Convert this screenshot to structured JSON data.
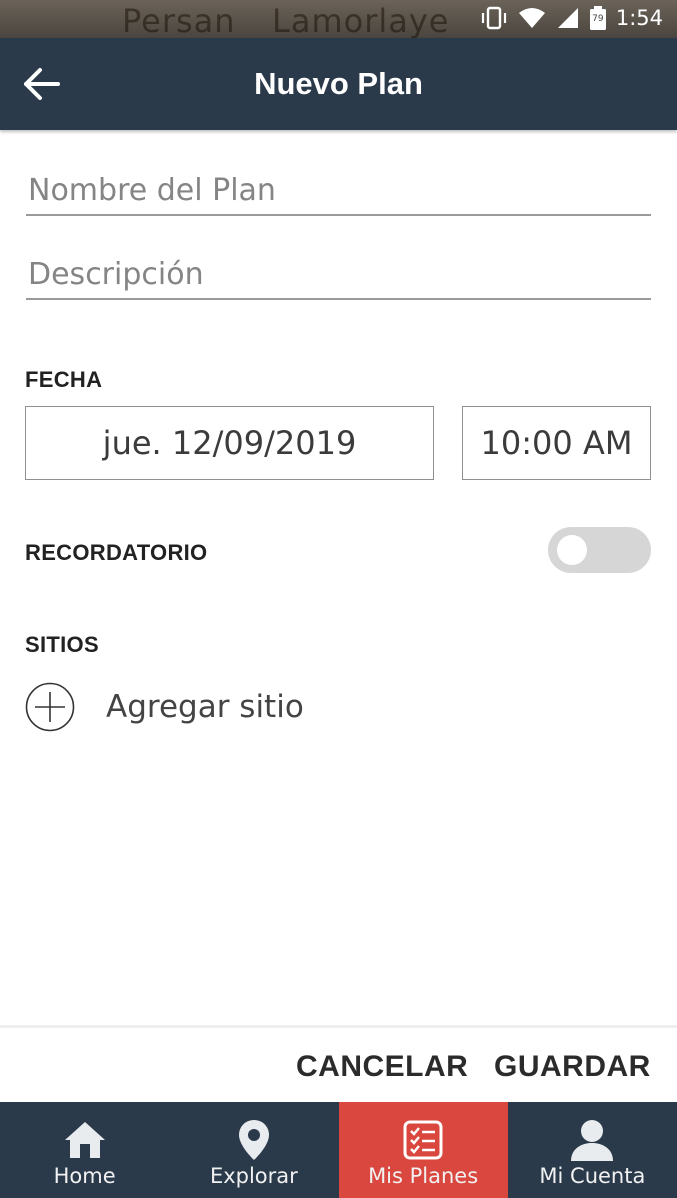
{
  "status_bar": {
    "background_text_left": "Persan",
    "background_text_right": "Lamorlaye",
    "battery_level": "79",
    "time": "1:54"
  },
  "app_bar": {
    "title": "Nuevo Plan",
    "back_icon": "arrow-left-icon",
    "background": "#2b3a4b"
  },
  "form": {
    "name_placeholder": "Nombre del Plan",
    "name_value": "",
    "description_placeholder": "Descripción",
    "description_value": "",
    "date_label": "FECHA",
    "date_value": "jue. 12/09/2019",
    "time_value": "10:00 AM",
    "reminder_label": "RECORDATORIO",
    "reminder_enabled": false,
    "sites_label": "SITIOS",
    "add_site_label": "Agregar sitio",
    "add_site_icon": "plus-circle-icon"
  },
  "actions": {
    "cancel_label": "CANCELAR",
    "save_label": "GUARDAR"
  },
  "bottom_nav": {
    "active_color": "#d9473e",
    "items": [
      {
        "label": "Home",
        "icon": "home-icon",
        "active": false
      },
      {
        "label": "Explorar",
        "icon": "location-pin-icon",
        "active": false
      },
      {
        "label": "Mis Planes",
        "icon": "checklist-icon",
        "active": true
      },
      {
        "label": "Mi Cuenta",
        "icon": "user-icon",
        "active": false
      }
    ]
  }
}
